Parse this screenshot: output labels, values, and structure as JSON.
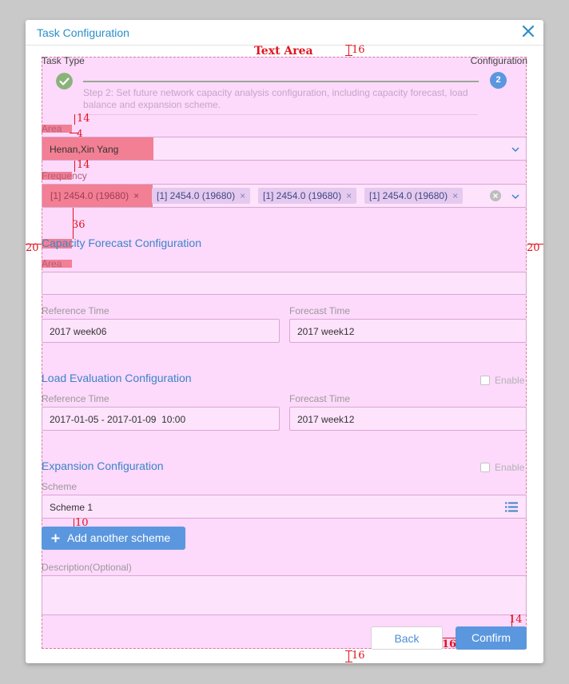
{
  "dialog": {
    "title": "Task Configuration"
  },
  "annotations": {
    "text_area_label": "Text Area",
    "gap_top": "16",
    "gap_bottom": "16",
    "gap_area_label": "14",
    "gap_label_field": "4",
    "gap_freq_label": "14",
    "gap_section": "36",
    "margin_left": "20",
    "margin_right": "20",
    "gap_add_btn": "10",
    "gap_buttons_top": "14",
    "gap_buttons": "16"
  },
  "steps": {
    "left_label": "Task Type",
    "right_label": "Configuration",
    "right_number": "2",
    "description": "Step 2: Set future network capacity analysis configuration, including capacity forecast, load balance and expansion scheme."
  },
  "area": {
    "label": "Area",
    "value": "Henan,Xin Yang"
  },
  "frequency": {
    "label": "Frequency",
    "tags": [
      "[1] 2454.0 (19680)",
      "[1] 2454.0 (19680)",
      "[1] 2454.0 (19680)",
      "[1] 2454.0 (19680)"
    ]
  },
  "capacity": {
    "title": "Capacity Forecast Configuration",
    "area_label": "Area",
    "area_value": "",
    "ref_label": "Reference Time",
    "ref_value": "2017 week06",
    "forecast_label": "Forecast Time",
    "forecast_value": "2017 week12"
  },
  "load": {
    "title": "Load Evaluation Configuration",
    "enable_label": "Enable",
    "ref_label": "Reference Time",
    "ref_value": "2017-01-05 - 2017-01-09  10:00",
    "forecast_label": "Forecast Time",
    "forecast_value": "2017 week12"
  },
  "expansion": {
    "title": "Expansion Configuration",
    "enable_label": "Enable",
    "scheme_label": "Scheme",
    "scheme_value": "Scheme 1",
    "add_button": "Add another scheme"
  },
  "description": {
    "label": "Description(Optional)",
    "value": ""
  },
  "buttons": {
    "back": "Back",
    "confirm": "Confirm"
  },
  "colors": {
    "accent": "#5b97de",
    "title": "#2b8fc8",
    "step_done": "#8ab37a",
    "highlight": "#f27f93",
    "annotation": "#e0141e"
  },
  "icons": [
    "close-icon",
    "check-icon",
    "chevron-down-icon",
    "clear-circle-icon",
    "list-icon",
    "plus-icon"
  ]
}
